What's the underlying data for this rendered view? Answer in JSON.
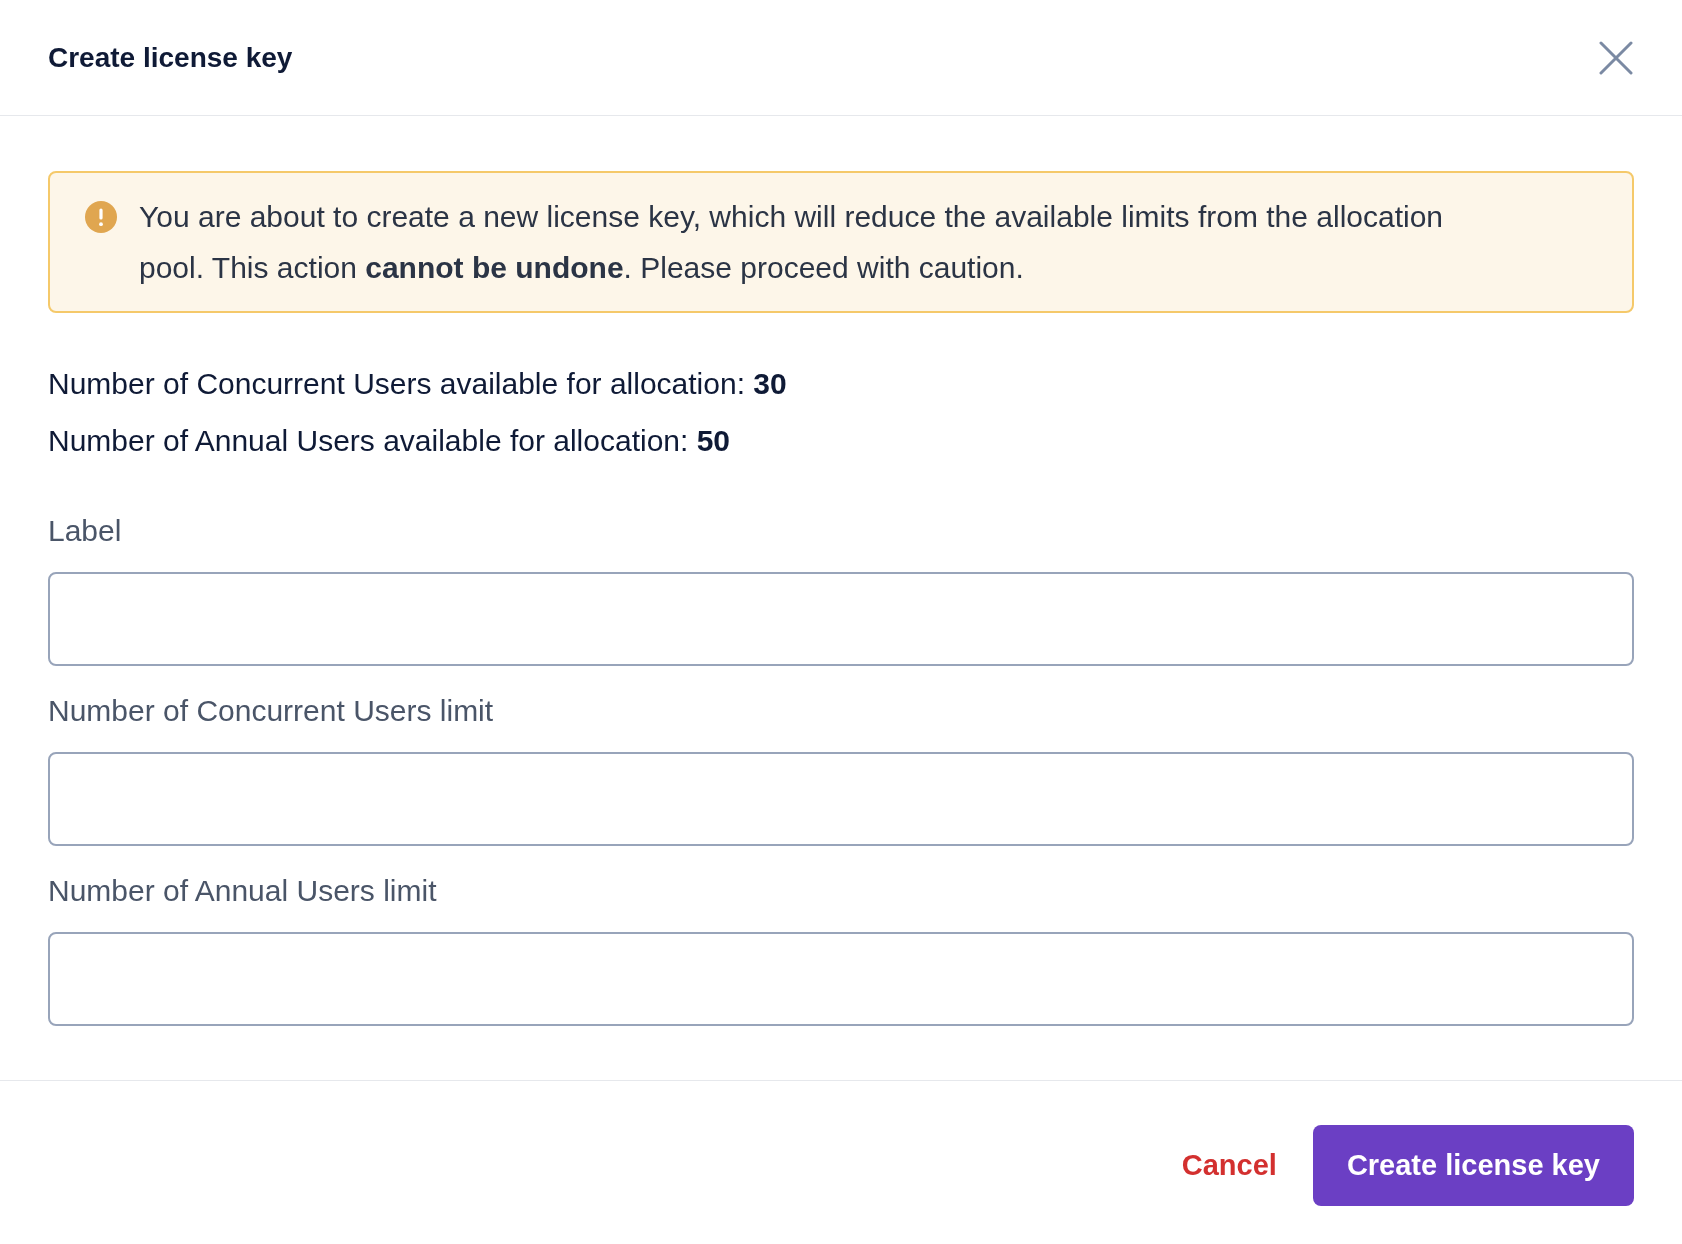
{
  "dialog": {
    "title": "Create license key"
  },
  "alert": {
    "kind": "warning",
    "text": "You are about to create a new license key, which will reduce the available limits from the allocation pool. This action **cannot be undone**. Please proceed with caution."
  },
  "availability": [
    {
      "text": "Number of Concurrent Users available for allocation: **30**"
    },
    {
      "text": "Number of Annual Users available for allocation: **50**"
    }
  ],
  "fields": [
    {
      "label": "Label"
    },
    {
      "label": "Number of Concurrent Users limit"
    },
    {
      "label": "Number of Annual Users limit"
    }
  ],
  "buttons": [
    {
      "label": "Cancel",
      "kind": "link"
    },
    {
      "label": "Create license key",
      "kind": "primary"
    }
  ]
}
